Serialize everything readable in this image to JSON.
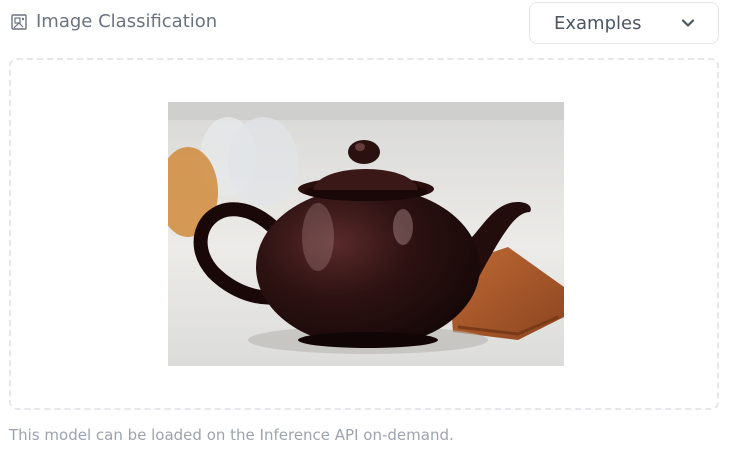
{
  "header": {
    "task_icon": "image-classification-icon",
    "task_label": "Image Classification",
    "examples_label": "Examples",
    "examples_icon": "chevron-down-icon"
  },
  "dropzone": {
    "preview_image": "brown glossy teapot on white marble with orange napkin"
  },
  "footer": {
    "note": "This model can be loaded on the Inference API on-demand."
  },
  "colors": {
    "label_gray": "#6b7280",
    "border_gray": "#e5e7eb",
    "teapot_brown": "#2b1111"
  }
}
